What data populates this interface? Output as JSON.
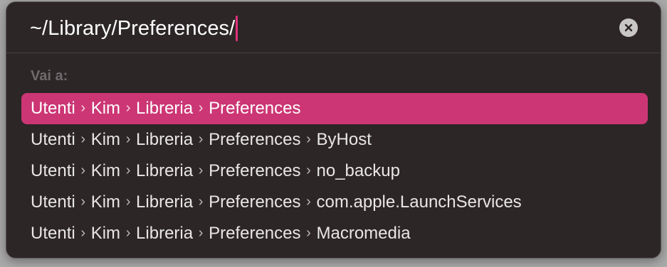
{
  "search": {
    "value": "~/Library/Preferences/"
  },
  "section_label": "Vai a:",
  "results": [
    {
      "selected": true,
      "segments": [
        "Utenti",
        "Kim",
        "Libreria",
        "Preferences"
      ]
    },
    {
      "selected": false,
      "segments": [
        "Utenti",
        "Kim",
        "Libreria",
        "Preferences",
        "ByHost"
      ]
    },
    {
      "selected": false,
      "segments": [
        "Utenti",
        "Kim",
        "Libreria",
        "Preferences",
        "no_backup"
      ]
    },
    {
      "selected": false,
      "segments": [
        "Utenti",
        "Kim",
        "Libreria",
        "Preferences",
        "com.apple.LaunchServices"
      ]
    },
    {
      "selected": false,
      "segments": [
        "Utenti",
        "Kim",
        "Libreria",
        "Preferences",
        "Macromedia"
      ]
    }
  ],
  "separator_glyph": "›",
  "icons": {
    "clear": "clear-icon"
  },
  "colors": {
    "accent": "#cc3674",
    "caret": "#e0307a",
    "panel_bg": "#2c2627"
  }
}
